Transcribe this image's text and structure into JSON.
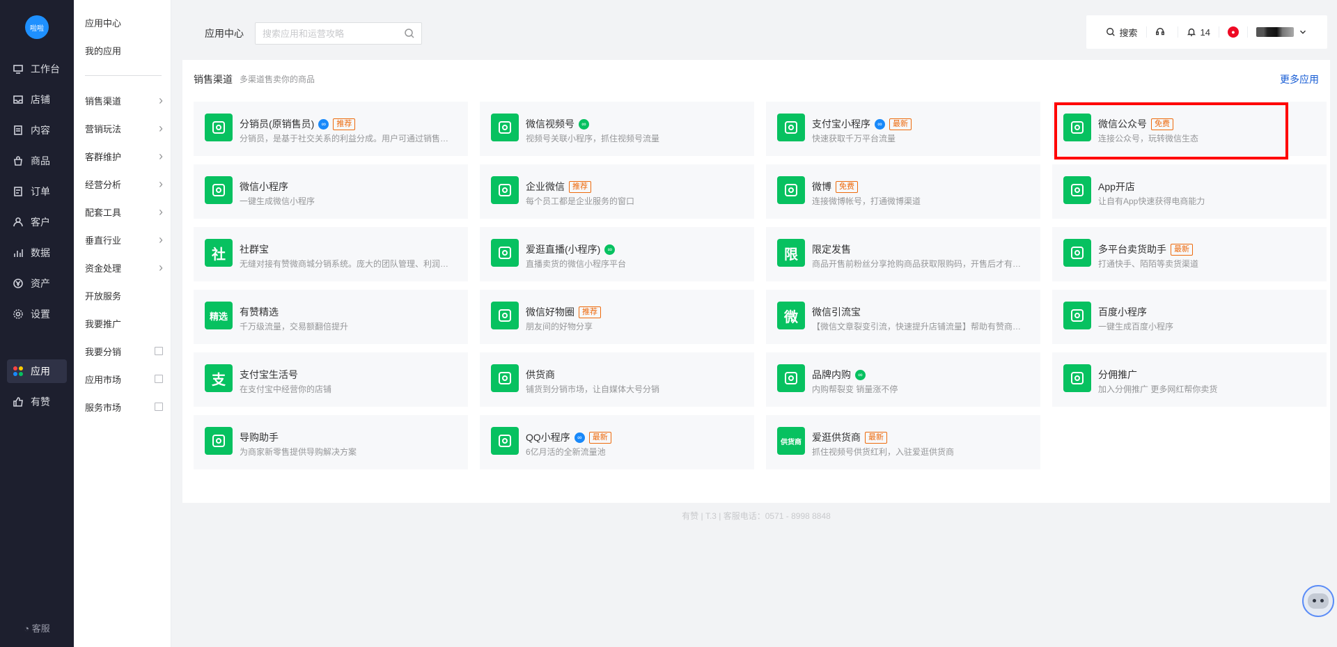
{
  "logo_text": "啦啦",
  "main_nav": [
    {
      "label": "工作台",
      "icon": "dashboard-icon"
    },
    {
      "label": "店铺",
      "icon": "store-icon"
    },
    {
      "label": "内容",
      "icon": "document-icon"
    },
    {
      "label": "商品",
      "icon": "bag-icon"
    },
    {
      "label": "订单",
      "icon": "order-icon"
    },
    {
      "label": "客户",
      "icon": "user-icon"
    },
    {
      "label": "数据",
      "icon": "chart-icon"
    },
    {
      "label": "资产",
      "icon": "yen-icon"
    },
    {
      "label": "设置",
      "icon": "gear-icon"
    },
    {
      "label": "应用",
      "icon": "apps-icon",
      "active": true
    },
    {
      "label": "有赞",
      "icon": "thumb-icon"
    }
  ],
  "kefu_label": "客服",
  "sub_nav": {
    "top": [
      "应用中心",
      "我的应用"
    ],
    "groups": [
      "销售渠道",
      "营销玩法",
      "客群维护",
      "经营分析",
      "配套工具",
      "垂直行业",
      "资金处理"
    ],
    "plain": [
      "开放服务",
      "我要推广"
    ],
    "external": [
      "我要分销",
      "应用市场",
      "服务市场"
    ]
  },
  "header": {
    "crumb": "应用中心",
    "search_placeholder": "搜索应用和运营攻略",
    "search_label": "搜索",
    "notify_count": "14"
  },
  "section": {
    "title": "销售渠道",
    "subtitle": "多渠道售卖你的商品",
    "more": "更多应用"
  },
  "apps": [
    {
      "name": "分销员(原销售员)",
      "desc": "分销员，是基于社交关系的利益分成。用户可通过销售员分享商品获得佣金",
      "tag": "推荐",
      "badge": "blue",
      "icon": "distributor-icon",
      "glyph": ""
    },
    {
      "name": "微信视频号",
      "desc": "视频号关联小程序，抓住视频号流量",
      "tag": "",
      "badge": "green",
      "icon": "wechat-channels-icon",
      "glyph": ""
    },
    {
      "name": "支付宝小程序",
      "desc": "快速获取千万平台流量",
      "tag": "最新",
      "badge": "blue",
      "icon": "alipay-miniapp-icon",
      "glyph": ""
    },
    {
      "name": "微信公众号",
      "desc": "连接公众号，玩转微信生态",
      "tag": "免费",
      "badge": "",
      "icon": "wechat-official-icon",
      "glyph": ""
    },
    {
      "name": "微信小程序",
      "desc": "一键生成微信小程序",
      "tag": "",
      "badge": "",
      "icon": "wechat-miniapp-icon",
      "glyph": ""
    },
    {
      "name": "企业微信",
      "desc": "每个员工都是企业服务的窗口",
      "tag": "推荐",
      "badge": "",
      "icon": "wecom-icon",
      "glyph": ""
    },
    {
      "name": "微博",
      "desc": "连接微博帐号，打通微博渠道",
      "tag": "免费",
      "badge": "",
      "icon": "weibo-icon",
      "glyph": ""
    },
    {
      "name": "App开店",
      "desc": "让自有App快速获得电商能力",
      "tag": "",
      "badge": "",
      "icon": "app-store-icon",
      "glyph": ""
    },
    {
      "name": "社群宝",
      "desc": "无缝对接有赞微商城分销系统。庞大的团队管理、利润分配功能",
      "tag": "",
      "badge": "",
      "icon": "community-icon",
      "glyph": "社"
    },
    {
      "name": "爱逛直播(小程序)",
      "desc": "直播卖货的微信小程序平台",
      "tag": "",
      "badge": "green",
      "icon": "live-stream-icon",
      "glyph": ""
    },
    {
      "name": "限定发售",
      "desc": "商品开售前粉丝分享抢购商品获取限购码，开售后才有资格购买",
      "tag": "",
      "badge": "",
      "icon": "limited-sale-icon",
      "glyph": "限"
    },
    {
      "name": "多平台卖货助手",
      "desc": "打通快手、陌陌等卖货渠道",
      "tag": "最新",
      "badge": "",
      "icon": "multi-platform-icon",
      "glyph": ""
    },
    {
      "name": "有赞精选",
      "desc": "千万级流量，交易额翻倍提升",
      "tag": "",
      "badge": "",
      "icon": "youzan-select-icon",
      "glyph": "精选"
    },
    {
      "name": "微信好物圈",
      "desc": "朋友间的好物分享",
      "tag": "推荐",
      "badge": "",
      "icon": "goods-circle-icon",
      "glyph": ""
    },
    {
      "name": "微信引流宝",
      "desc": "【微信文章裂变引流，快速提升店铺流量】帮助有赞商家实现引流",
      "tag": "",
      "badge": "",
      "icon": "traffic-icon",
      "glyph": "微"
    },
    {
      "name": "百度小程序",
      "desc": "一键生成百度小程序",
      "tag": "",
      "badge": "",
      "icon": "baidu-miniapp-icon",
      "glyph": ""
    },
    {
      "name": "支付宝生活号",
      "desc": "在支付宝中经营你的店铺",
      "tag": "",
      "badge": "",
      "icon": "alipay-life-icon",
      "glyph": "支"
    },
    {
      "name": "供货商",
      "desc": "铺货到分销市场，让自媒体大号分销",
      "tag": "",
      "badge": "",
      "icon": "supplier-icon",
      "glyph": ""
    },
    {
      "name": "品牌内购",
      "desc": "内购帮裂变 销量涨不停",
      "tag": "",
      "badge": "green",
      "icon": "brand-purchase-icon",
      "glyph": ""
    },
    {
      "name": "分佣推广",
      "desc": "加入分佣推广 更多网红帮你卖货",
      "tag": "",
      "badge": "",
      "icon": "commission-icon",
      "glyph": ""
    },
    {
      "name": "导购助手",
      "desc": "为商家新零售提供导购解决方案",
      "tag": "",
      "badge": "",
      "icon": "guide-icon",
      "glyph": ""
    },
    {
      "name": "QQ小程序",
      "desc": "6亿月活的全新流量池",
      "tag": "最新",
      "badge": "blue",
      "icon": "qq-miniapp-icon",
      "glyph": ""
    },
    {
      "name": "爱逛供货商",
      "desc": "抓住视频号供货红利，入驻爱逛供货商",
      "tag": "最新",
      "badge": "",
      "icon": "aiguang-supplier-icon",
      "glyph": "供货商"
    }
  ],
  "footer": "有赞 | T.3 | 客服电话：0571 - 8998 8848",
  "colors": {
    "accent_green": "#07c160",
    "link_blue": "#155bd4",
    "tag_orange": "#ed6a0c",
    "sidebar": "#1d1f2e",
    "highlight": "#ff0000"
  }
}
